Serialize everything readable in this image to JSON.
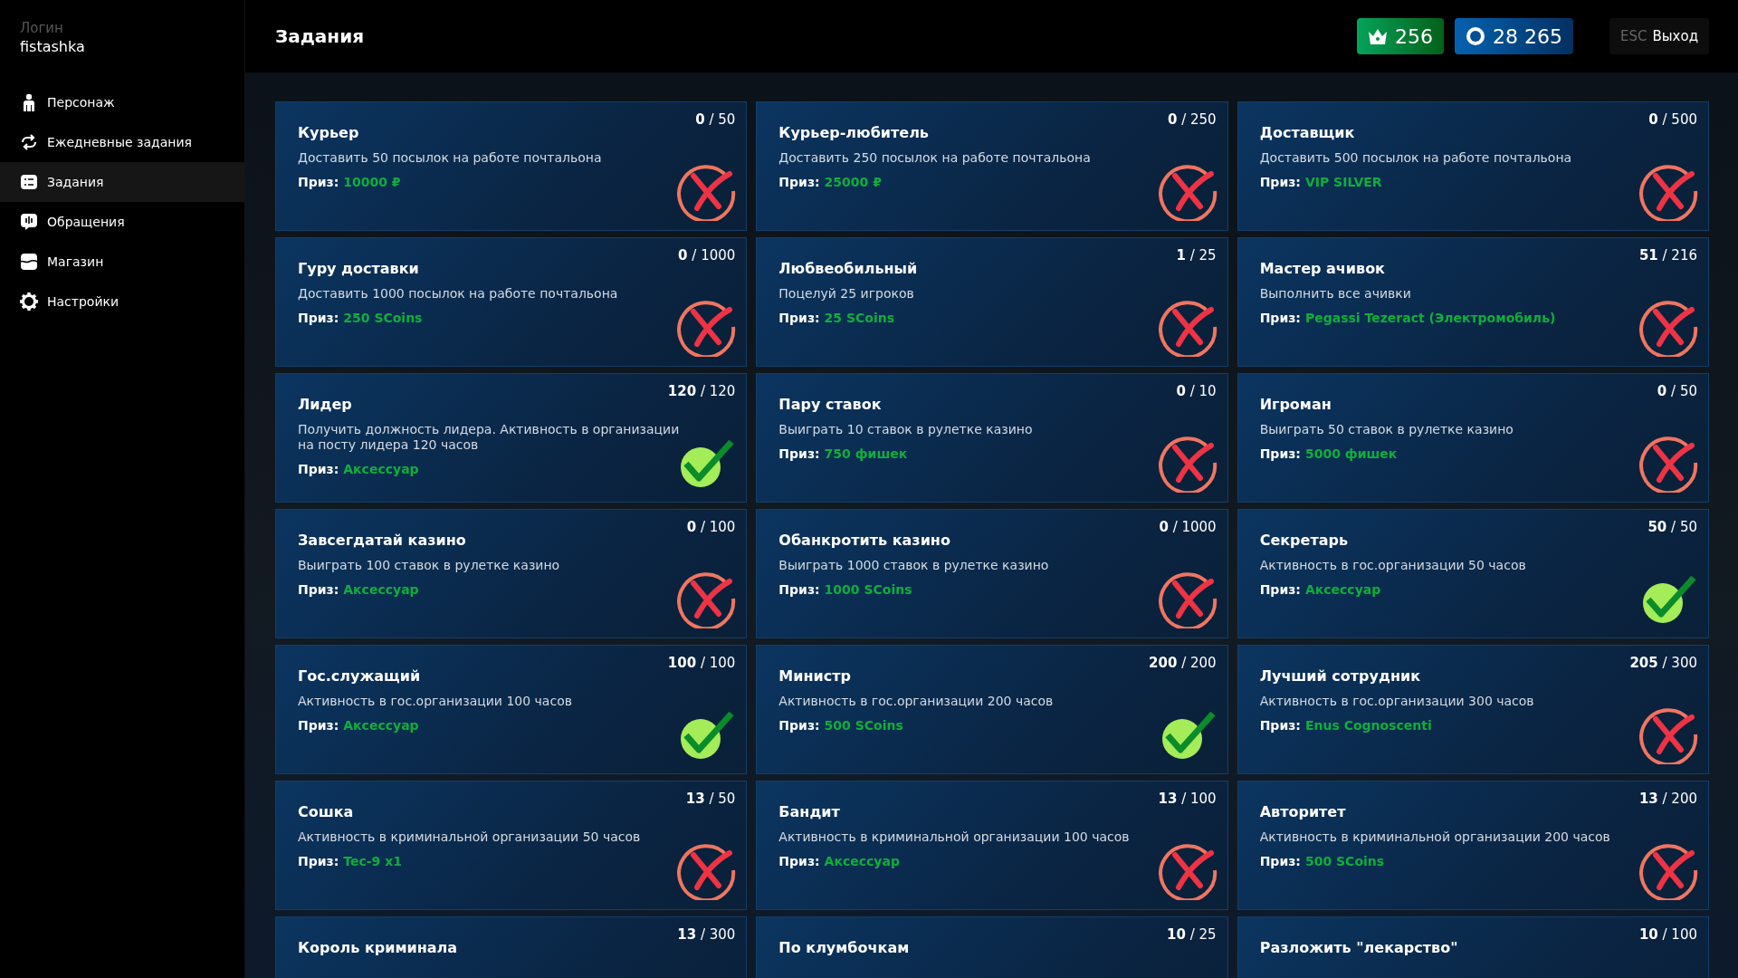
{
  "sidebar": {
    "login_label": "Логин",
    "login": "fistashka",
    "items": [
      {
        "label": "Персонаж",
        "kind": "person",
        "selected": false
      },
      {
        "label": "Ежедневные задания",
        "kind": "daily",
        "selected": false
      },
      {
        "label": "Задания",
        "kind": "tasks",
        "selected": true
      },
      {
        "label": "Обращения",
        "kind": "reports",
        "selected": false
      },
      {
        "label": "Магазин",
        "kind": "shop",
        "selected": false
      },
      {
        "label": "Настройки",
        "kind": "settings",
        "selected": false
      }
    ]
  },
  "header": {
    "title": "Задания",
    "crowns": "256",
    "coins": "28 265",
    "exit_key": "ESC",
    "exit_label": "Выход"
  },
  "tasks": [
    {
      "title": "Курьер",
      "progress_count": "0",
      "progress_total": "/ 50",
      "description": "Доставить 50 посылок на работе почтальона",
      "prize_label": "Приз:",
      "prize": "10000 ₽",
      "completed": false
    },
    {
      "title": "Курьер-любитель",
      "progress_count": "0",
      "progress_total": "/ 250",
      "description": "Доставить 250 посылок на работе почтальона",
      "prize_label": "Приз:",
      "prize": "25000 ₽",
      "completed": false
    },
    {
      "title": "Доставщик",
      "progress_count": "0",
      "progress_total": "/ 500",
      "description": "Доставить 500 посылок на работе почтальона",
      "prize_label": "Приз:",
      "prize": "VIP SILVER",
      "completed": false
    },
    {
      "title": "Гуру доставки",
      "progress_count": "0",
      "progress_total": "/ 1000",
      "description": "Доставить 1000 посылок на работе почтальона",
      "prize_label": "Приз:",
      "prize": "250 SCoins",
      "completed": false
    },
    {
      "title": "Любвеобильный",
      "progress_count": "1",
      "progress_total": "/ 25",
      "description": "Поцелуй 25 игроков",
      "prize_label": "Приз:",
      "prize": "25 SCoins",
      "completed": false
    },
    {
      "title": "Мастер ачивок",
      "progress_count": "51",
      "progress_total": "/ 216",
      "description": "Выполнить все ачивки",
      "prize_label": "Приз:",
      "prize": "Pegassi Tezeract (Электромобиль)",
      "completed": false
    },
    {
      "title": "Лидер",
      "progress_count": "120",
      "progress_total": "/ 120",
      "description": "Получить должность лидера. Активность в организации на посту лидера 120 часов",
      "prize_label": "Приз:",
      "prize": "Аксессуар",
      "completed": true
    },
    {
      "title": "Пару ставок",
      "progress_count": "0",
      "progress_total": "/ 10",
      "description": "Выиграть 10 ставок в рулетке казино",
      "prize_label": "Приз:",
      "prize": "750 фишек",
      "completed": false
    },
    {
      "title": "Игроман",
      "progress_count": "0",
      "progress_total": "/ 50",
      "description": "Выиграть 50 ставок в рулетке казино",
      "prize_label": "Приз:",
      "prize": "5000 фишек",
      "completed": false
    },
    {
      "title": "Завсегдатай казино",
      "progress_count": "0",
      "progress_total": "/ 100",
      "description": "Выиграть 100 ставок в рулетке казино",
      "prize_label": "Приз:",
      "prize": "Аксессуар",
      "completed": false
    },
    {
      "title": "Обанкротить казино",
      "progress_count": "0",
      "progress_total": "/ 1000",
      "description": "Выиграть 1000 ставок в рулетке казино",
      "prize_label": "Приз:",
      "prize": "1000 SCoins",
      "completed": false
    },
    {
      "title": "Секретарь",
      "progress_count": "50",
      "progress_total": "/ 50",
      "description": "Активность в гос.организации 50 часов",
      "prize_label": "Приз:",
      "prize": "Аксессуар",
      "completed": true
    },
    {
      "title": "Гос.служащий",
      "progress_count": "100",
      "progress_total": "/ 100",
      "description": "Активность в гос.организации 100 часов",
      "prize_label": "Приз:",
      "prize": "Аксессуар",
      "completed": true
    },
    {
      "title": "Министр",
      "progress_count": "200",
      "progress_total": "/ 200",
      "description": "Активность в гос.организации 200 часов",
      "prize_label": "Приз:",
      "prize": "500 SCoins",
      "completed": true
    },
    {
      "title": "Лучший сотрудник",
      "progress_count": "205",
      "progress_total": "/ 300",
      "description": "Активность в гос.организации 300 часов",
      "prize_label": "Приз:",
      "prize": "Enus Cognoscenti",
      "completed": false
    },
    {
      "title": "Сошка",
      "progress_count": "13",
      "progress_total": "/ 50",
      "description": "Активность в криминальной организации 50 часов",
      "prize_label": "Приз:",
      "prize": "Tec-9 x1",
      "completed": false
    },
    {
      "title": "Бандит",
      "progress_count": "13",
      "progress_total": "/ 100",
      "description": "Активность в криминальной организации 100 часов",
      "prize_label": "Приз:",
      "prize": "Аксессуар",
      "completed": false
    },
    {
      "title": "Авторитет",
      "progress_count": "13",
      "progress_total": "/ 200",
      "description": "Активность в криминальной организации 200 часов",
      "prize_label": "Приз:",
      "prize": "500 SCoins",
      "completed": false
    },
    {
      "title": "Король криминала",
      "progress_count": "13",
      "progress_total": "/ 300"
    },
    {
      "title": "По клумбочкам",
      "progress_count": "10",
      "progress_total": "/ 25"
    },
    {
      "title": "Разложить \"лекарство\"",
      "progress_count": "10",
      "progress_total": "/ 100"
    }
  ]
}
